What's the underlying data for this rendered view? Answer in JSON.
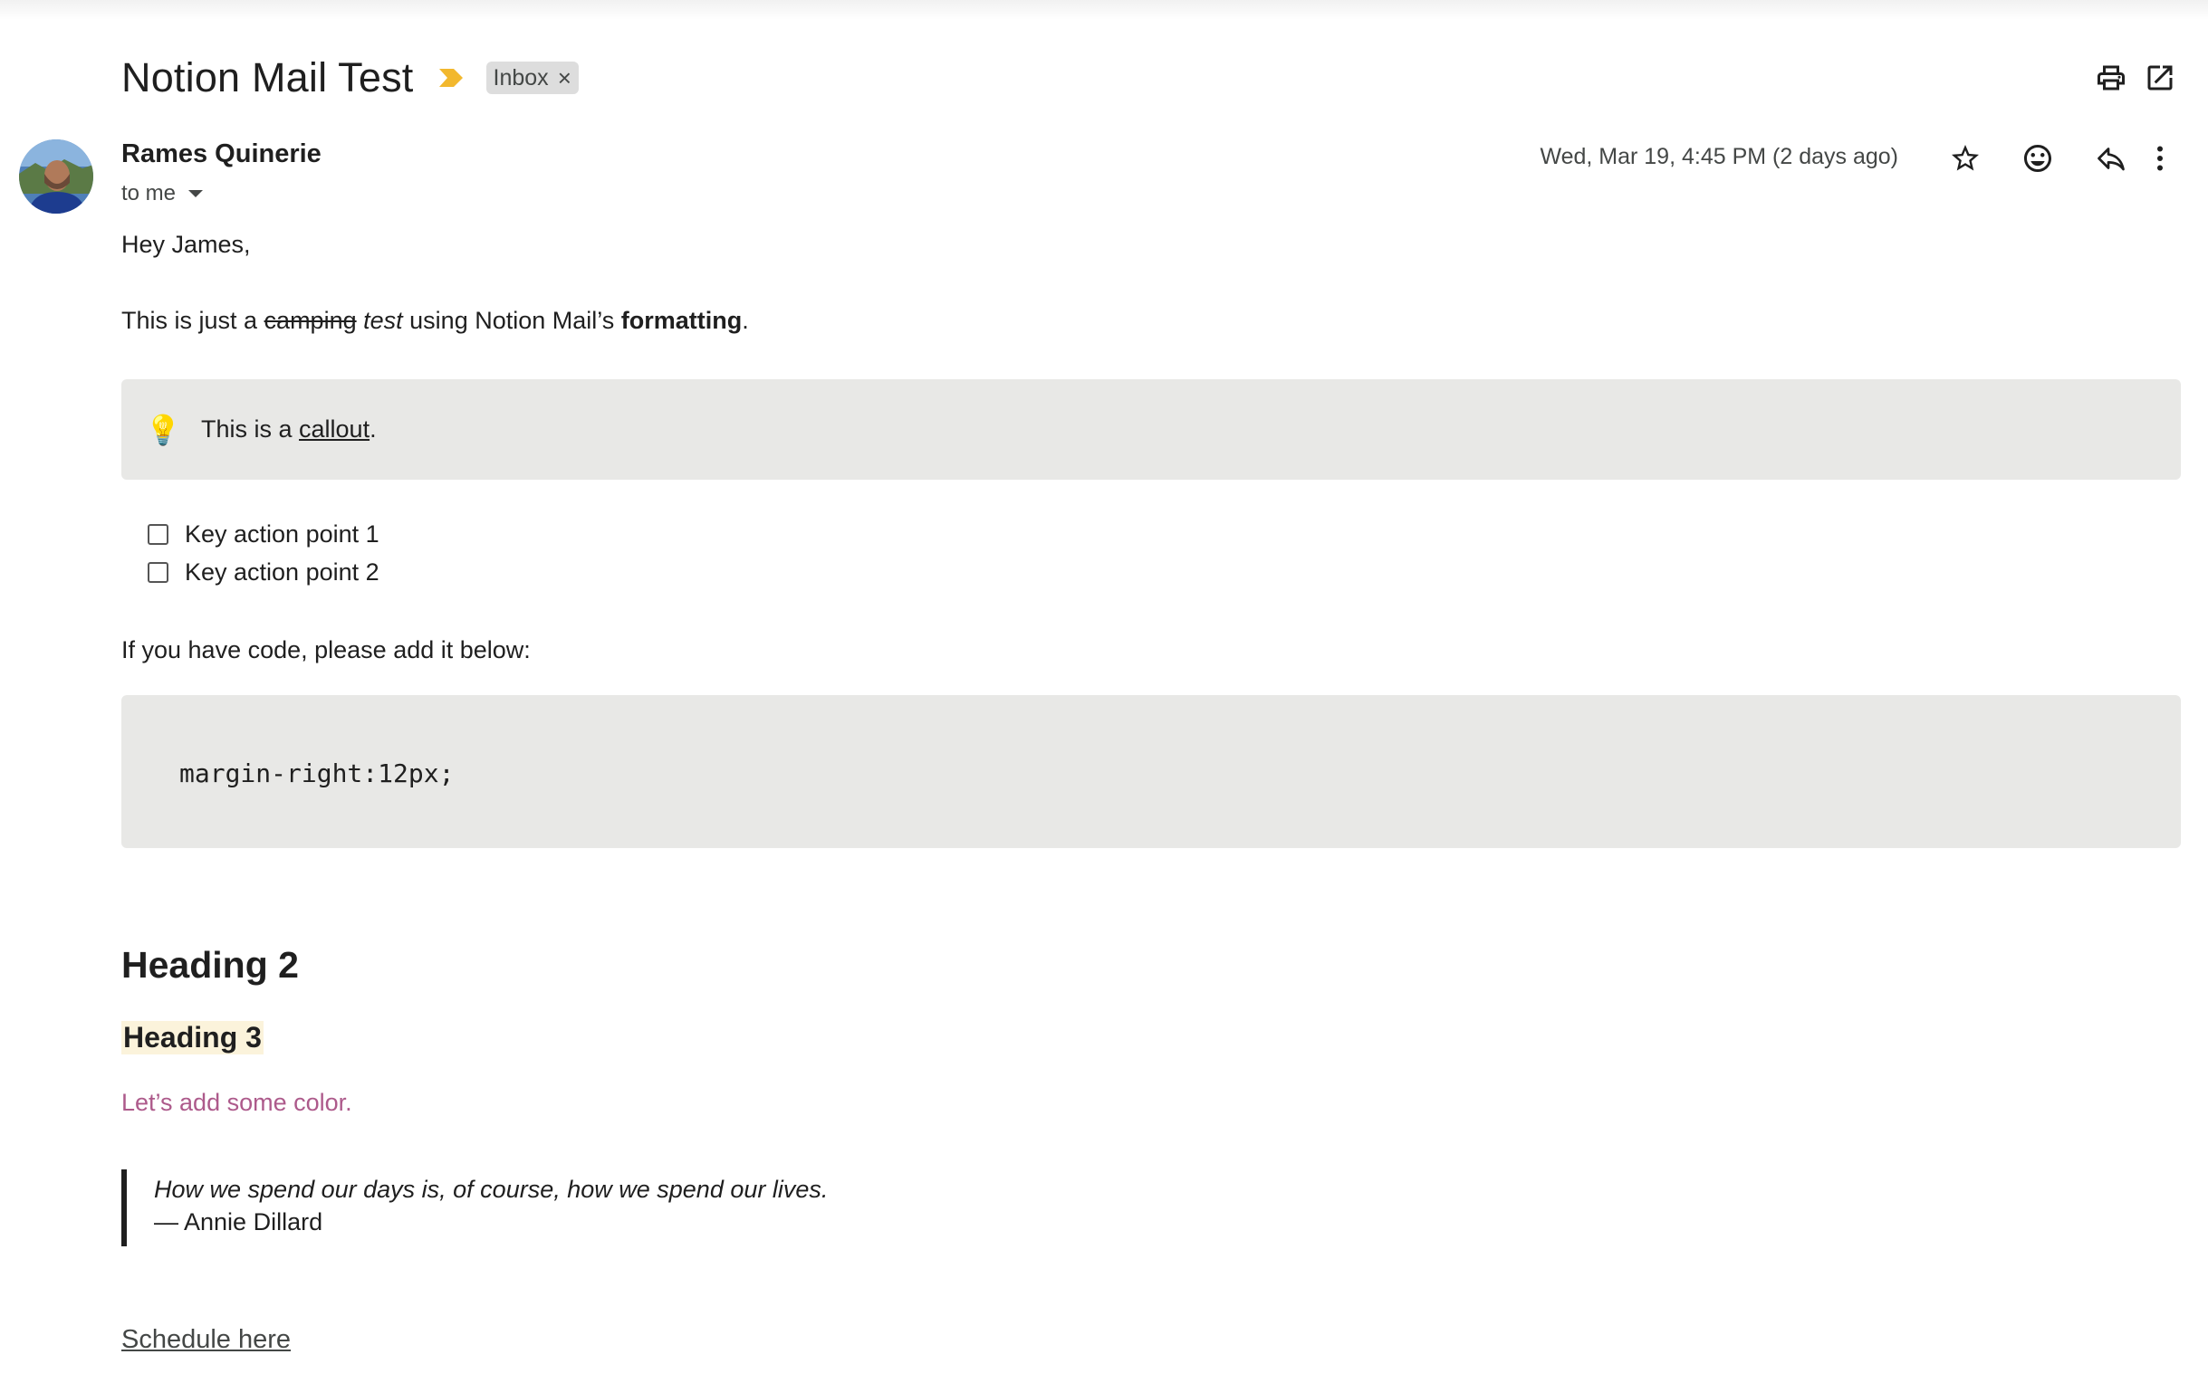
{
  "email": {
    "subject": "Notion Mail Test",
    "label": "Inbox",
    "label_remove": "×",
    "sender": "Rames Quinerie",
    "recipient": "to me",
    "date": "Wed, Mar 19, 4:45 PM (2 days ago)"
  },
  "toolbar": {
    "icons": [
      "print-icon",
      "open-in-new-window-icon",
      "star-icon",
      "emoji-icon",
      "reply-icon",
      "more-vert-icon"
    ]
  },
  "body": {
    "greeting": "Hey James,",
    "intro": {
      "prefix": "This is just a ",
      "strike": "camping",
      "space": " ",
      "italic": "test",
      "middle": " using Notion Mail’s ",
      "bold": "formatting",
      "suffix": "."
    },
    "callout": {
      "emoji": "💡",
      "prefix": "This is a ",
      "link": "callout",
      "suffix": "."
    },
    "todos": [
      "Key action point 1",
      "Key action point 2"
    ],
    "code_prompt": "If you have code, please add it below:",
    "code": "margin-right:12px;",
    "heading2": "Heading 2",
    "heading3": "Heading 3",
    "colored_text": "Let’s add some color.",
    "quote": {
      "text": "How we spend our days is, of course, how we spend our lives.",
      "author": "— Annie Dillard"
    },
    "schedule_link": "Schedule here"
  },
  "colors": {
    "callout_bg": "#e8e8e6",
    "code_bg": "#e8e8e6",
    "heading3_highlight": "#fbf3db",
    "colored_text": "#ad5a8b",
    "importance_marker": "#f2b82e"
  }
}
